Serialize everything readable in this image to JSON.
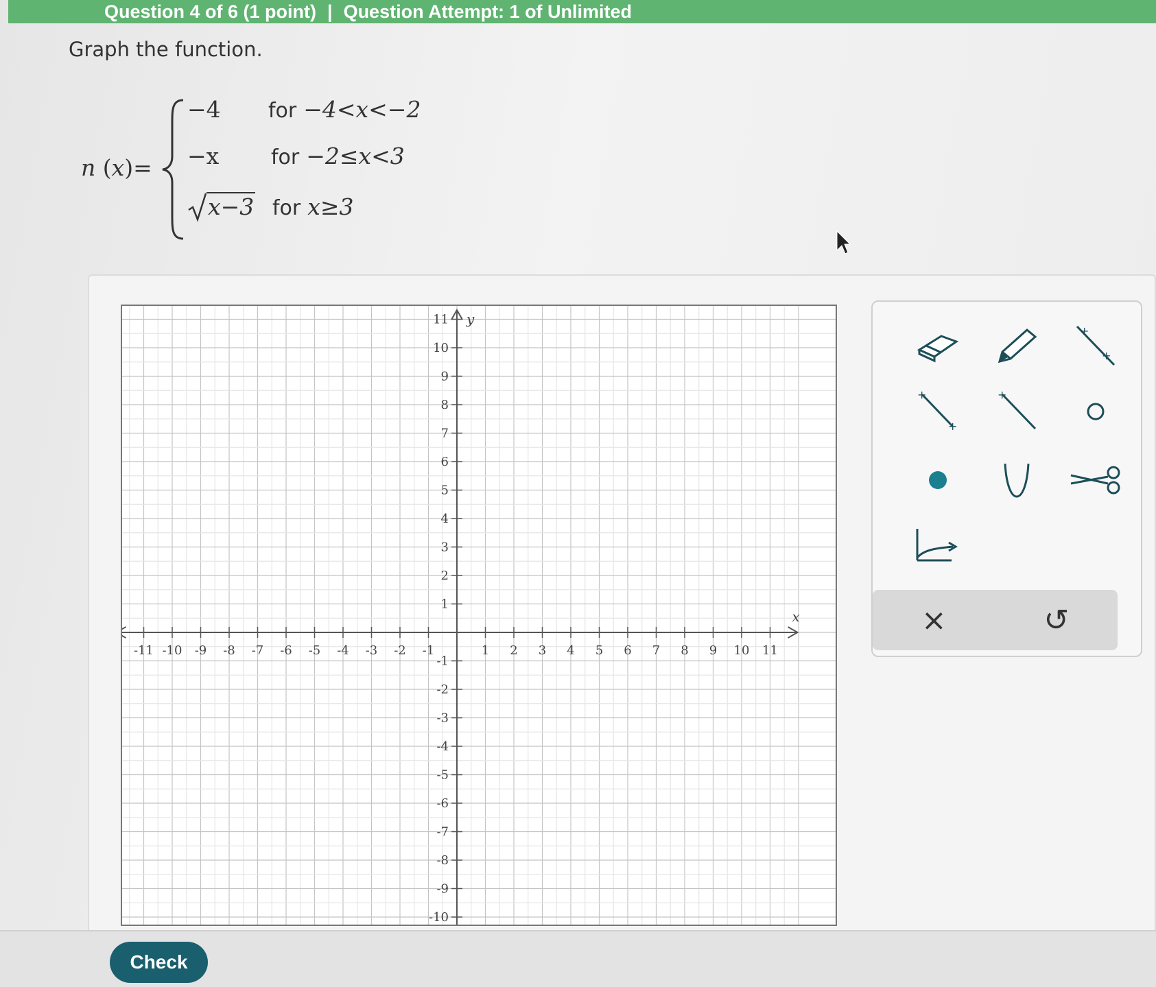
{
  "header": {
    "question": "Question 4 of 6 (1 point)",
    "attempt": "Question Attempt: 1 of Unlimited"
  },
  "instruction": "Graph the function.",
  "function": {
    "name": "n",
    "variable": "x",
    "pieces": [
      {
        "expression": "−4",
        "condition": "−4<x<−2"
      },
      {
        "expression": "−x",
        "condition": "−2≤x<3"
      },
      {
        "expression": "x−3",
        "condition": "x≥3"
      }
    ],
    "for_word": "for"
  },
  "graph": {
    "x_label": "x",
    "y_label": "y",
    "x_ticks": [
      "-11",
      "-10",
      "-9",
      "-8",
      "-7",
      "-6",
      "-5",
      "-4",
      "-3",
      "-2",
      "-1",
      "1",
      "2",
      "3",
      "4",
      "5",
      "6",
      "7",
      "8",
      "9",
      "10",
      "11"
    ],
    "y_ticks": [
      "11",
      "10",
      "9",
      "8",
      "7",
      "6",
      "5",
      "4",
      "3",
      "2",
      "1",
      "-1",
      "-2",
      "-3",
      "-4",
      "-5",
      "-6",
      "-7",
      "-8",
      "-9",
      "-10"
    ],
    "x_range": [
      -11,
      11
    ],
    "y_range": [
      -10,
      11
    ]
  },
  "tools": [
    {
      "name": "eraser-tool",
      "icon": "eraser-icon"
    },
    {
      "name": "pencil-tool",
      "icon": "pencil-icon"
    },
    {
      "name": "line-tool",
      "icon": "line-icon"
    },
    {
      "name": "segment-tool",
      "icon": "segment-icon"
    },
    {
      "name": "ray-tool",
      "icon": "ray-icon"
    },
    {
      "name": "open-point-tool",
      "icon": "open-circle-icon"
    },
    {
      "name": "closed-point-tool",
      "icon": "closed-circle-icon"
    },
    {
      "name": "curve-tool",
      "icon": "curve-icon"
    },
    {
      "name": "scissors-tool",
      "icon": "scissors-icon"
    },
    {
      "name": "sqrt-curve-tool",
      "icon": "sqrt-curve-icon"
    }
  ],
  "actions": {
    "clear": "×",
    "undo": "↺"
  },
  "check_label": "Check",
  "colors": {
    "header": "#5fb471",
    "accent": "#1a7f8e",
    "check": "#1a5f6e"
  }
}
